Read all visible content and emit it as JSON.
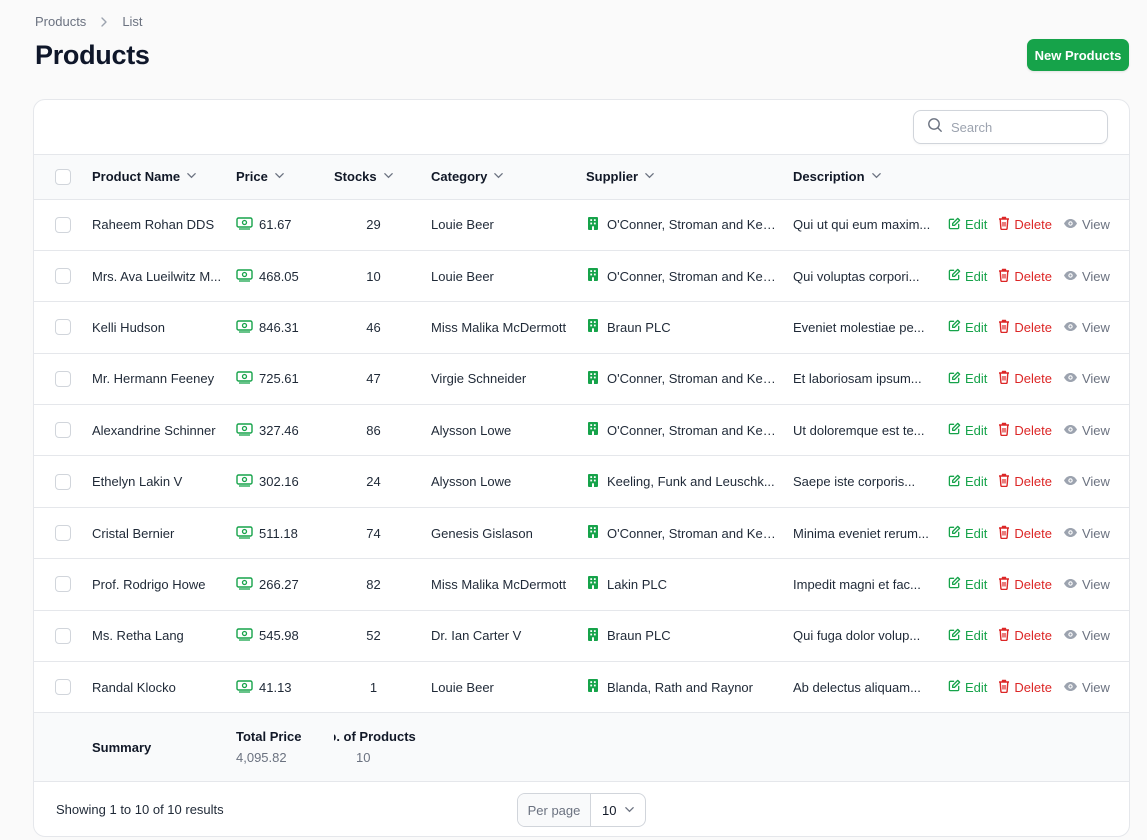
{
  "breadcrumb": [
    "Products",
    "List"
  ],
  "page_title": "Products",
  "new_button": "New Products",
  "search": {
    "placeholder": "Search"
  },
  "columns": [
    "Product Name",
    "Price",
    "Stocks",
    "Category",
    "Supplier",
    "Description"
  ],
  "actions": {
    "edit": "Edit",
    "delete": "Delete",
    "view": "View"
  },
  "rows": [
    {
      "name": "Raheem Rohan DDS",
      "price": "61.67",
      "stock": "29",
      "category": "Louie Beer",
      "supplier": "O'Conner, Stroman and Kes...",
      "description": "Qui ut qui eum maxim..."
    },
    {
      "name": "Mrs. Ava Lueilwitz M...",
      "price": "468.05",
      "stock": "10",
      "category": "Louie Beer",
      "supplier": "O'Conner, Stroman and Kes...",
      "description": "Qui voluptas corpori..."
    },
    {
      "name": "Kelli Hudson",
      "price": "846.31",
      "stock": "46",
      "category": "Miss Malika McDermott",
      "supplier": "Braun PLC",
      "description": "Eveniet molestiae pe..."
    },
    {
      "name": "Mr. Hermann Feeney",
      "price": "725.61",
      "stock": "47",
      "category": "Virgie Schneider",
      "supplier": "O'Conner, Stroman and Kes...",
      "description": "Et laboriosam ipsum..."
    },
    {
      "name": "Alexandrine Schinner",
      "price": "327.46",
      "stock": "86",
      "category": "Alysson Lowe",
      "supplier": "O'Conner, Stroman and Kes...",
      "description": "Ut doloremque est te..."
    },
    {
      "name": "Ethelyn Lakin V",
      "price": "302.16",
      "stock": "24",
      "category": "Alysson Lowe",
      "supplier": "Keeling, Funk and Leuschk...",
      "description": "Saepe iste corporis..."
    },
    {
      "name": "Cristal Bernier",
      "price": "511.18",
      "stock": "74",
      "category": "Genesis Gislason",
      "supplier": "O'Conner, Stroman and Kes...",
      "description": "Minima eveniet rerum..."
    },
    {
      "name": "Prof. Rodrigo Howe",
      "price": "266.27",
      "stock": "82",
      "category": "Miss Malika McDermott",
      "supplier": "Lakin PLC",
      "description": "Impedit magni et fac..."
    },
    {
      "name": "Ms. Retha Lang",
      "price": "545.98",
      "stock": "52",
      "category": "Dr. Ian Carter V",
      "supplier": "Braun PLC",
      "description": "Qui fuga dolor volup..."
    },
    {
      "name": "Randal Klocko",
      "price": "41.13",
      "stock": "1",
      "category": "Louie Beer",
      "supplier": "Blanda, Rath and Raynor",
      "description": "Ab delectus aliquam..."
    }
  ],
  "summary": {
    "title": "Summary",
    "total_price_label": "Total Price",
    "total_price": "4,095.82",
    "count_label": "No. of Products",
    "count": "10"
  },
  "footer": {
    "showing": "Showing 1 to 10 of 10 results",
    "per_page_label": "Per page",
    "per_page_value": "10"
  },
  "colors": {
    "primary": "#16a34a",
    "danger": "#dc2626",
    "muted": "#6b7280"
  },
  "icons": {
    "price": "banknote-icon",
    "supplier": "building-icon",
    "edit": "pencil-square-icon",
    "delete": "trash-icon",
    "view": "eye-icon",
    "search": "search-icon",
    "sort": "chevron-down-icon"
  }
}
